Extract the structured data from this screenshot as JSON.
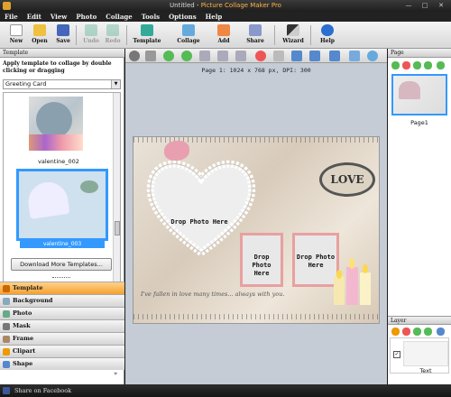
{
  "window": {
    "title_prefix": "Untitled - ",
    "title_brand": "Picture Collage Maker Pro",
    "min": "—",
    "max": "□",
    "close": "✕"
  },
  "menu": [
    "File",
    "Edit",
    "View",
    "Photo",
    "Collage",
    "Tools",
    "Options",
    "Help"
  ],
  "toolbar": {
    "new": "New",
    "open": "Open",
    "save": "Save",
    "undo": "Undo",
    "redo": "Redo",
    "template": "Template",
    "collage": "Collage",
    "add": "Add",
    "share": "Share",
    "wizard": "Wizard",
    "help": "Help"
  },
  "left_panel": {
    "title": "Template",
    "hint": "Apply template to collage by double clicking or dragging",
    "category_select": "Greeting Card",
    "templates": [
      {
        "name": "valentine_002"
      },
      {
        "name": "valentine_003"
      }
    ],
    "download_button": "Download More Templates...",
    "categories": [
      "Template",
      "Background",
      "Photo",
      "Mask",
      "Frame",
      "Clipart",
      "Shape"
    ],
    "more_glyph": "»"
  },
  "canvas": {
    "page_info": "Page 1: 1024 x 768 px, DPI: 300",
    "heart_drop": "Drop Photo Here",
    "drop2": "Drop Photo Here",
    "drop3": "Drop Photo Here",
    "love_text": "LOVE",
    "caption": "I've fallen in love many times... always with you."
  },
  "right_panel": {
    "page_title": "Page",
    "page_label": "Page1",
    "layer_title": "Layer",
    "layer_label": "Text",
    "layer_checked": "✓"
  },
  "status": {
    "share": "Share on Facebook"
  },
  "colors": {
    "accent": "#3399ff",
    "active_tab": "#f5a030",
    "title_brand": "#ffb347"
  }
}
